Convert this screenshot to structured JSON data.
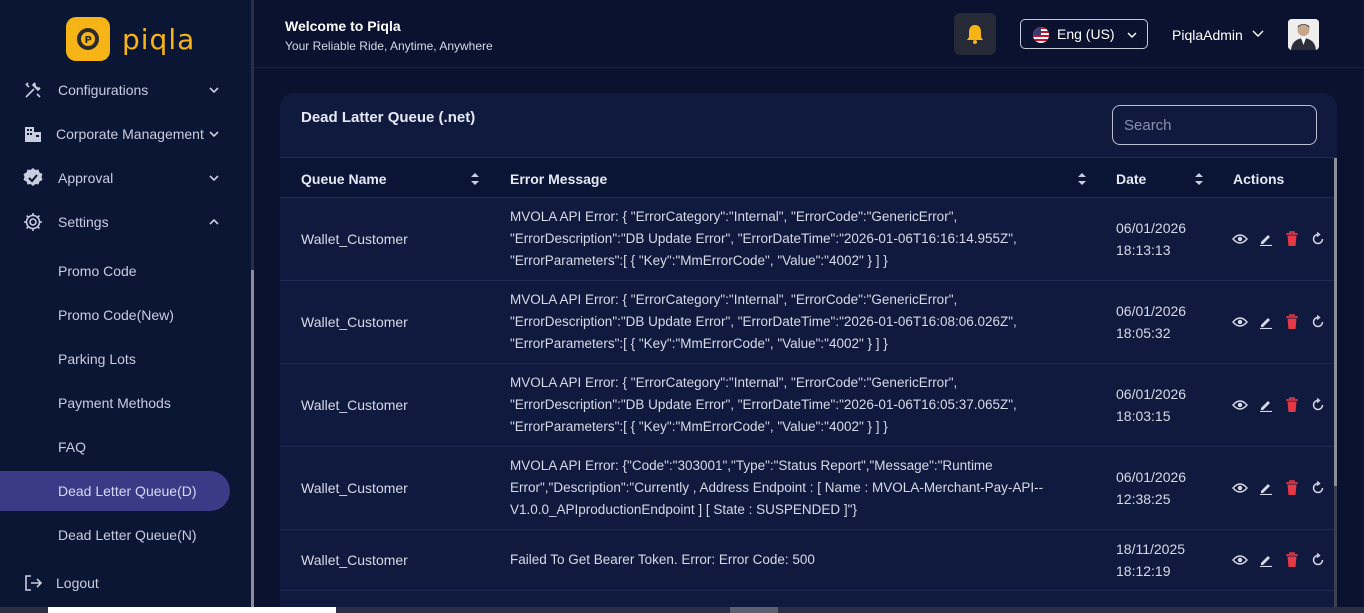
{
  "brand": {
    "logo_text": "piqla",
    "accent": "#f7b417"
  },
  "sidebar": {
    "items": [
      {
        "label": "Configurations",
        "icon": "tools-icon",
        "expanded": false
      },
      {
        "label": "Corporate Management",
        "icon": "building-icon",
        "expanded": false
      },
      {
        "label": "Approval",
        "icon": "badge-check-icon",
        "expanded": false
      },
      {
        "label": "Settings",
        "icon": "gear-icon",
        "expanded": true
      }
    ],
    "settings_sub": [
      {
        "label": "Promo Code"
      },
      {
        "label": "Promo Code(New)"
      },
      {
        "label": "Parking Lots"
      },
      {
        "label": "Payment Methods"
      },
      {
        "label": "FAQ"
      },
      {
        "label": "Dead Letter Queue(D)",
        "active": true
      },
      {
        "label": "Dead Letter Queue(N)"
      }
    ],
    "logout_label": "Logout"
  },
  "header": {
    "title": "Welcome to Piqla",
    "subtitle": "Your Reliable Ride, Anytime, Anywhere",
    "language": "Eng (US)",
    "user_name": "PiqlaAdmin"
  },
  "card": {
    "title": "Dead Latter Queue (.net)",
    "search_placeholder": "Search"
  },
  "table": {
    "columns": [
      "Queue Name",
      "Error Message",
      "Date",
      "Actions"
    ],
    "rows": [
      {
        "queue": "Wallet_Customer",
        "message": "MVOLA API Error: { \"ErrorCategory\":\"Internal\", \"ErrorCode\":\"GenericError\", \"ErrorDescription\":\"DB Update Error\", \"ErrorDateTime\":\"2026-01-06T16:16:14.955Z\", \"ErrorParameters\":[ { \"Key\":\"MmErrorCode\", \"Value\":\"4002\" } ] }",
        "date": "06/01/2026",
        "time": "18:13:13"
      },
      {
        "queue": "Wallet_Customer",
        "message": "MVOLA API Error: { \"ErrorCategory\":\"Internal\", \"ErrorCode\":\"GenericError\", \"ErrorDescription\":\"DB Update Error\", \"ErrorDateTime\":\"2026-01-06T16:08:06.026Z\", \"ErrorParameters\":[ { \"Key\":\"MmErrorCode\", \"Value\":\"4002\" } ] }",
        "date": "06/01/2026",
        "time": "18:05:32"
      },
      {
        "queue": "Wallet_Customer",
        "message": "MVOLA API Error: { \"ErrorCategory\":\"Internal\", \"ErrorCode\":\"GenericError\", \"ErrorDescription\":\"DB Update Error\", \"ErrorDateTime\":\"2026-01-06T16:05:37.065Z\", \"ErrorParameters\":[ { \"Key\":\"MmErrorCode\", \"Value\":\"4002\" } ] }",
        "date": "06/01/2026",
        "time": "18:03:15"
      },
      {
        "queue": "Wallet_Customer",
        "message": "MVOLA API Error: {\"Code\":\"303001\",\"Type\":\"Status Report\",\"Message\":\"Runtime Error\",\"Description\":\"Currently , Address Endpoint : [ Name : MVOLA-Merchant-Pay-API--V1.0.0_APIproductionEndpoint ] [ State : SUSPENDED ]\"}",
        "date": "06/01/2026",
        "time": "12:38:25"
      },
      {
        "queue": "Wallet_Customer",
        "message": "Failed To Get Bearer Token. Error: Error Code: 500",
        "date": "18/11/2025",
        "time": "18:12:19"
      }
    ]
  },
  "colors": {
    "delete": "#e63946",
    "active_nav": "#3a3a86"
  }
}
